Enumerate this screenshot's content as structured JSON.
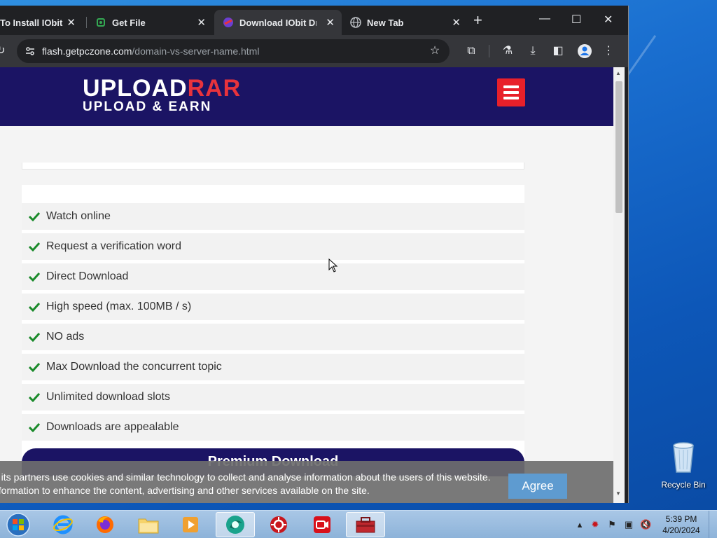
{
  "browser": {
    "tabs": [
      {
        "label": "To Install IObit",
        "close": "✕"
      },
      {
        "label": "Get File",
        "close": "✕"
      },
      {
        "label": "Download IObit Driv",
        "close": "✕",
        "active": true
      },
      {
        "label": "New Tab",
        "close": "✕"
      }
    ],
    "new_tab": "+",
    "window_controls": {
      "minimize": "—",
      "maximize": "☐",
      "close": "✕"
    },
    "address": {
      "domain": "flash.getpczone.com",
      "path": "/domain-vs-server-name.html"
    }
  },
  "site": {
    "logo": {
      "line1_white": "UPL",
      "line1_o": "O",
      "line1_white2": "AD",
      "line1_red": "RAR",
      "line2": "UPLOAD & EARN"
    },
    "features": [
      "Watch online",
      "Request a verification word",
      "Direct Download",
      "High speed (max. 100MB / s)",
      "NO ads",
      "Max Download the concurrent topic",
      "Unlimited download slots",
      "Downloads are appealable"
    ],
    "premium_button": "Premium Download",
    "cookie": {
      "line1": "d its partners use cookies and similar technology to collect and analyse information about the users of this website.",
      "line2": "nformation to enhance the content, advertising and other services available on the site.",
      "agree": "Agree"
    }
  },
  "desktop": {
    "recycle_bin": "Recycle Bin"
  },
  "taskbar": {
    "time": "5:39 PM",
    "date": "4/20/2024"
  },
  "colors": {
    "brand_navy": "#1b1464",
    "brand_red": "#e8202a",
    "check_green": "#1a8a2a"
  }
}
